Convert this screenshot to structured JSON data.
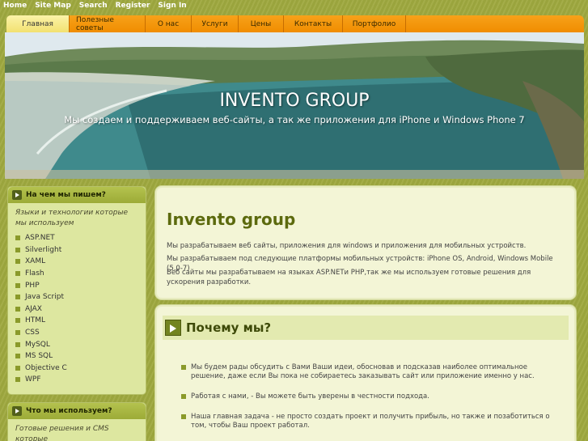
{
  "topbar": {
    "links": [
      "Home",
      "Site Map",
      "Search",
      "Register",
      "Sign In"
    ]
  },
  "nav": {
    "items": [
      "Главная",
      "Полезные советы",
      "О нас",
      "Услуги",
      "Цены",
      "Контакты",
      "Портфолио"
    ],
    "active_index": 0
  },
  "header": {
    "title": "INVENTO GROUP",
    "subtitle": "Мы создаем и поддерживаем веб-сайты, а так же приложения для iPhone и Windows Phone 7"
  },
  "sidebar": {
    "box1": {
      "title": "На чем мы пишем?",
      "intro": "Языки и технологии которые мы используем",
      "items": [
        "ASP.NET",
        "Silverlight",
        "XAML",
        "Flash",
        "PHP",
        "Java Script",
        "AJAX",
        "HTML",
        "CSS",
        "MySQL",
        "MS SQL",
        "Objective C",
        "WPF"
      ]
    },
    "box2": {
      "title": "Что мы используем?",
      "intro": "Готовые решения и CMS которые"
    }
  },
  "main": {
    "intro_panel": {
      "title": "Invento group",
      "paragraphs": [
        "Мы разрабатываем веб сайты, приложения для windows и приложения для мобильных устройств.",
        "Мы разрабатываем под следующие платформы мобильных устройств: iPhone OS, Android, Windows Mobile (5.0-7)",
        "Веб сайты мы разрабатываем на языках ASP.NETи PHP,так же мы используем готовые решения для ускорения разработки."
      ]
    },
    "why_panel": {
      "title": "Почему мы?",
      "points": [
        "Мы будем рады обсудить с Вами Ваши идеи, обосновав и подсказав наиболее оптимальное решение, даже если Вы пока не собираетесь заказывать сайт или приложение именно у нас.",
        "Работая с нами, - Вы можете быть уверены в честности подхода.",
        "Наша главная задача - не просто создать проект и получить прибыль, но также и позаботиться о том, чтобы Ваш проект работал."
      ]
    }
  }
}
